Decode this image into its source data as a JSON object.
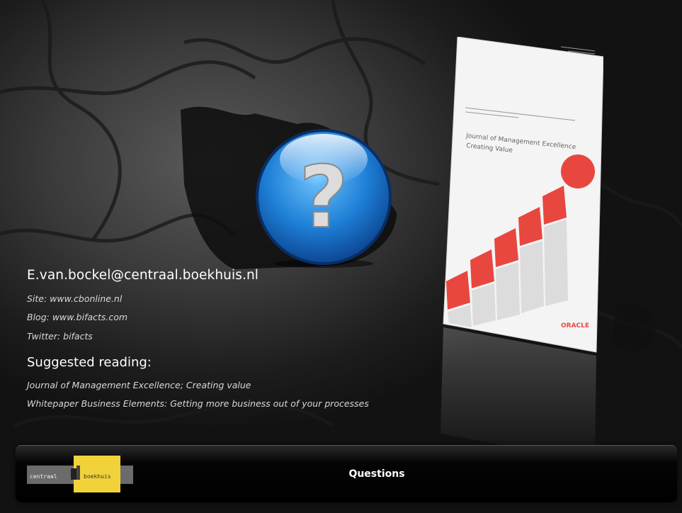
{
  "contact": {
    "email": "E.van.bockel@centraal.boekhuis.nl",
    "site": "Site: www.cbonline.nl",
    "blog": "Blog: www.bifacts.com",
    "twitter": "Twitter: bifacts"
  },
  "reading": {
    "heading": "Suggested reading:",
    "items": [
      "Journal of Management Excellence; Creating value",
      "Whitepaper Business Elements: Getting more business out of your processes"
    ]
  },
  "footer": {
    "title": "Questions",
    "logo_left": "centraal",
    "logo_right": "boekhuis"
  },
  "document": {
    "title_line1": "Journal of Management Excellence",
    "title_line2": "Creating Value",
    "brand": "ORACLE"
  },
  "colors": {
    "orb": "#1e7fd6",
    "logo_yellow": "#f2d23a",
    "accent_red": "#e8473f"
  }
}
